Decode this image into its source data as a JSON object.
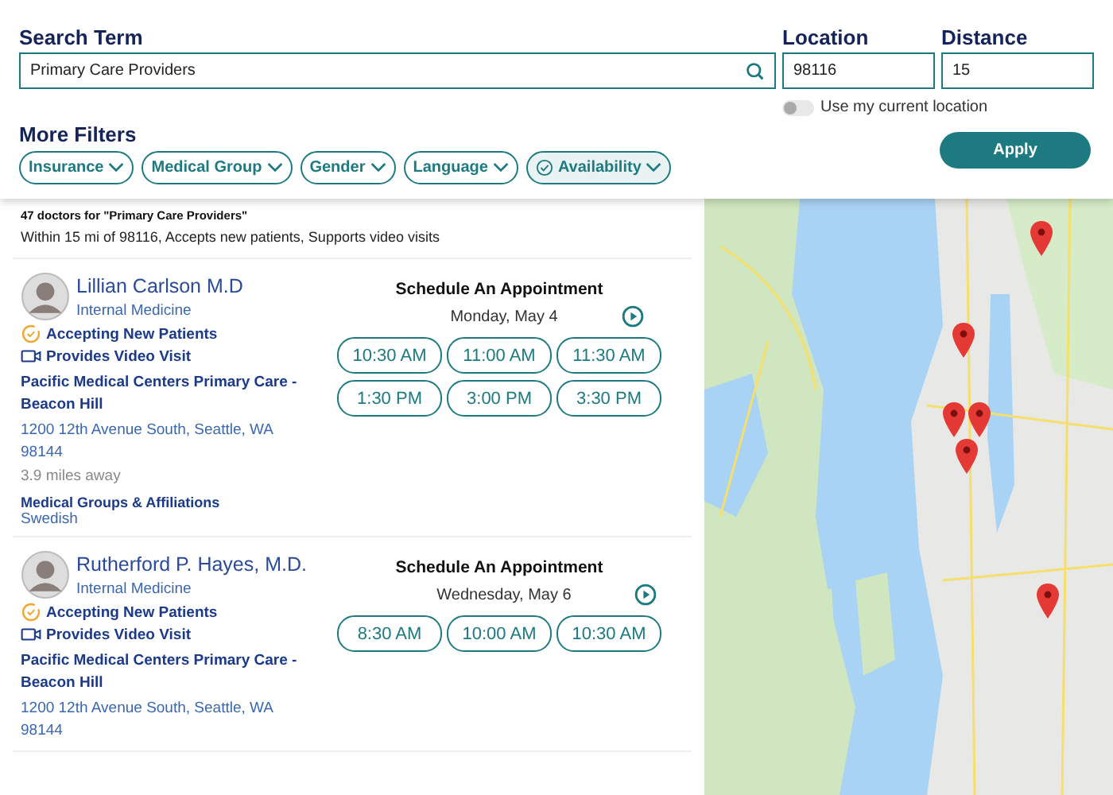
{
  "search": {
    "label": "Search Term",
    "value": "Primary Care Providers"
  },
  "location": {
    "label": "Location",
    "value": "98116"
  },
  "distance": {
    "label": "Distance",
    "value": "15"
  },
  "current_location": {
    "label": "Use my current location",
    "on": false
  },
  "filters": {
    "label": "More Filters",
    "chips": [
      {
        "label": "Insurance",
        "selected": false
      },
      {
        "label": "Medical Group",
        "selected": false
      },
      {
        "label": "Gender",
        "selected": false
      },
      {
        "label": "Language",
        "selected": false
      },
      {
        "label": "Availability",
        "selected": true
      }
    ]
  },
  "apply_button": "Apply",
  "results": {
    "count": "47 doctors for \"Primary Care Providers\"",
    "criteria": "Within 15 mi of 98116, Accepts new patients, Supports video visits"
  },
  "doctors": [
    {
      "name": "Lillian Carlson M.D",
      "specialty": "Internal Medicine",
      "accepting": "Accepting New Patients",
      "video": "Provides Video Visit",
      "practice": "Pacific Medical Centers Primary Care - Beacon Hill",
      "address": "1200 12th Avenue South, Seattle, WA 98144",
      "distance": "3.9 miles away",
      "groups_label": "Medical Groups & Affiliations",
      "groups": "Swedish",
      "schedule_title": "Schedule An Appointment",
      "date": "Monday, May 4",
      "slots": [
        "10:30 AM",
        "11:00 AM",
        "11:30 AM",
        "1:30 PM",
        "3:00 PM",
        "3:30 PM"
      ]
    },
    {
      "name": "Rutherford P. Hayes, M.D.",
      "specialty": "Internal Medicine",
      "accepting": "Accepting New Patients",
      "video": "Provides Video Visit",
      "practice": "Pacific Medical Centers Primary Care - Beacon Hill",
      "address": "1200 12th Avenue South, Seattle, WA 98144",
      "schedule_title": "Schedule An Appointment",
      "date": "Wednesday, May 6",
      "slots": [
        "8:30 AM",
        "10:00 AM",
        "10:30 AM"
      ]
    }
  ]
}
